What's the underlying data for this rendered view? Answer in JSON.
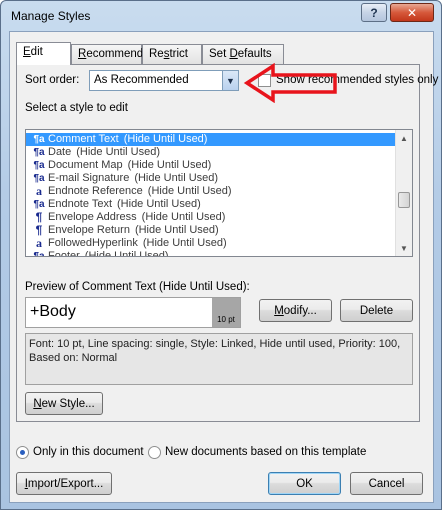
{
  "window": {
    "title": "Manage Styles",
    "help_label": "?",
    "close_label": "✕"
  },
  "tabs": [
    {
      "mnemonic": "E",
      "rest": "dit"
    },
    {
      "mnemonic": "R",
      "rest": "ecommend"
    },
    {
      "pre": "Re",
      "mnemonic": "s",
      "rest": "trict"
    },
    {
      "pre": "Set ",
      "mnemonic": "D",
      "rest": "efaults"
    }
  ],
  "sort": {
    "label": "Sort order:",
    "value": "As Recommended",
    "dropdown_icon": "chevron-down-icon",
    "show_recommended_label": "Show recommended styles only",
    "show_recommended_checked": false
  },
  "style_list": {
    "label": "Select a style to edit",
    "items": [
      {
        "icon": "¶a",
        "icon_type": "linked",
        "name": "Comment Text",
        "note": "(Hide Until Used)",
        "selected": true
      },
      {
        "icon": "¶a",
        "icon_type": "linked",
        "name": "Date",
        "note": "(Hide Until Used)",
        "selected": false
      },
      {
        "icon": "¶a",
        "icon_type": "linked",
        "name": "Document Map",
        "note": "(Hide Until Used)",
        "selected": false
      },
      {
        "icon": "¶a",
        "icon_type": "linked",
        "name": "E-mail Signature",
        "note": "(Hide Until Used)",
        "selected": false
      },
      {
        "icon": "a",
        "icon_type": "char",
        "name": "Endnote Reference",
        "note": "(Hide Until Used)",
        "selected": false
      },
      {
        "icon": "¶a",
        "icon_type": "linked",
        "name": "Endnote Text",
        "note": "(Hide Until Used)",
        "selected": false
      },
      {
        "icon": "¶",
        "icon_type": "para",
        "name": "Envelope Address",
        "note": "(Hide Until Used)",
        "selected": false
      },
      {
        "icon": "¶",
        "icon_type": "para",
        "name": "Envelope Return",
        "note": "(Hide Until Used)",
        "selected": false
      },
      {
        "icon": "a",
        "icon_type": "char",
        "name": "FollowedHyperlink",
        "note": "(Hide Until Used)",
        "selected": false
      },
      {
        "icon": "¶a",
        "icon_type": "linked",
        "name": "Footer",
        "note": "(Hide Until Used)",
        "selected": false
      }
    ]
  },
  "preview": {
    "label": "Preview of Comment Text  (Hide Until Used):",
    "text": "+Body",
    "size": "10 pt",
    "modify_label": "Modify...",
    "modify_mnemonic": "M",
    "delete_label": "Delete",
    "description": "Font: 10 pt, Line spacing:  single, Style: Linked, Hide until used, Priority: 100, Based on: Normal"
  },
  "new_style": {
    "mnemonic": "N",
    "rest": "ew Style..."
  },
  "scope": {
    "only_this_document": "Only in this document",
    "new_documents": "New documents based on this template",
    "selected": "only_this_document"
  },
  "footer": {
    "import_export_pre": "",
    "import_export_mnemonic": "I",
    "import_export_rest": "mport/Export...",
    "ok_label": "OK",
    "cancel_label": "Cancel"
  },
  "colors": {
    "selection": "#3399ff",
    "annotation_arrow": "#e8141c",
    "close_button": "#c2371b"
  }
}
